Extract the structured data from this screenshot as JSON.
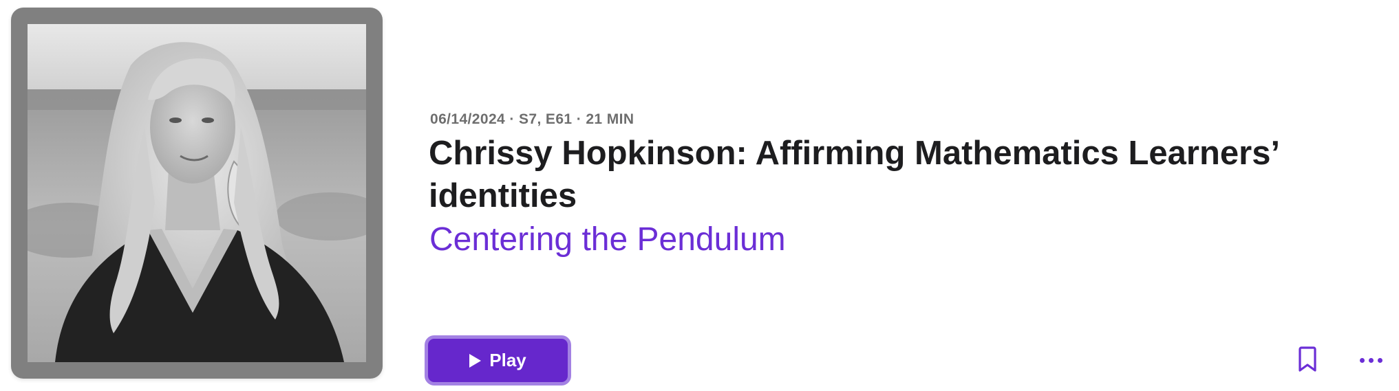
{
  "episode": {
    "meta": "06/14/2024 · S7, E61 · 21 MIN",
    "title": "Chrissy Hopkinson: Affirming Mathematics Learners’ identities",
    "show_name": "Centering the Pendulum"
  },
  "actions": {
    "play_label": "Play",
    "play_icon": "play-icon",
    "bookmark_icon": "bookmark-icon",
    "more_icon": "ellipsis-icon"
  },
  "colors": {
    "accent": "#6b2ed6",
    "play_button_bg": "#6627cc",
    "play_button_border": "#a381e3",
    "artwork_frame": "#808080",
    "title_text": "#1d1d1f",
    "meta_text": "#6e6e6e"
  }
}
